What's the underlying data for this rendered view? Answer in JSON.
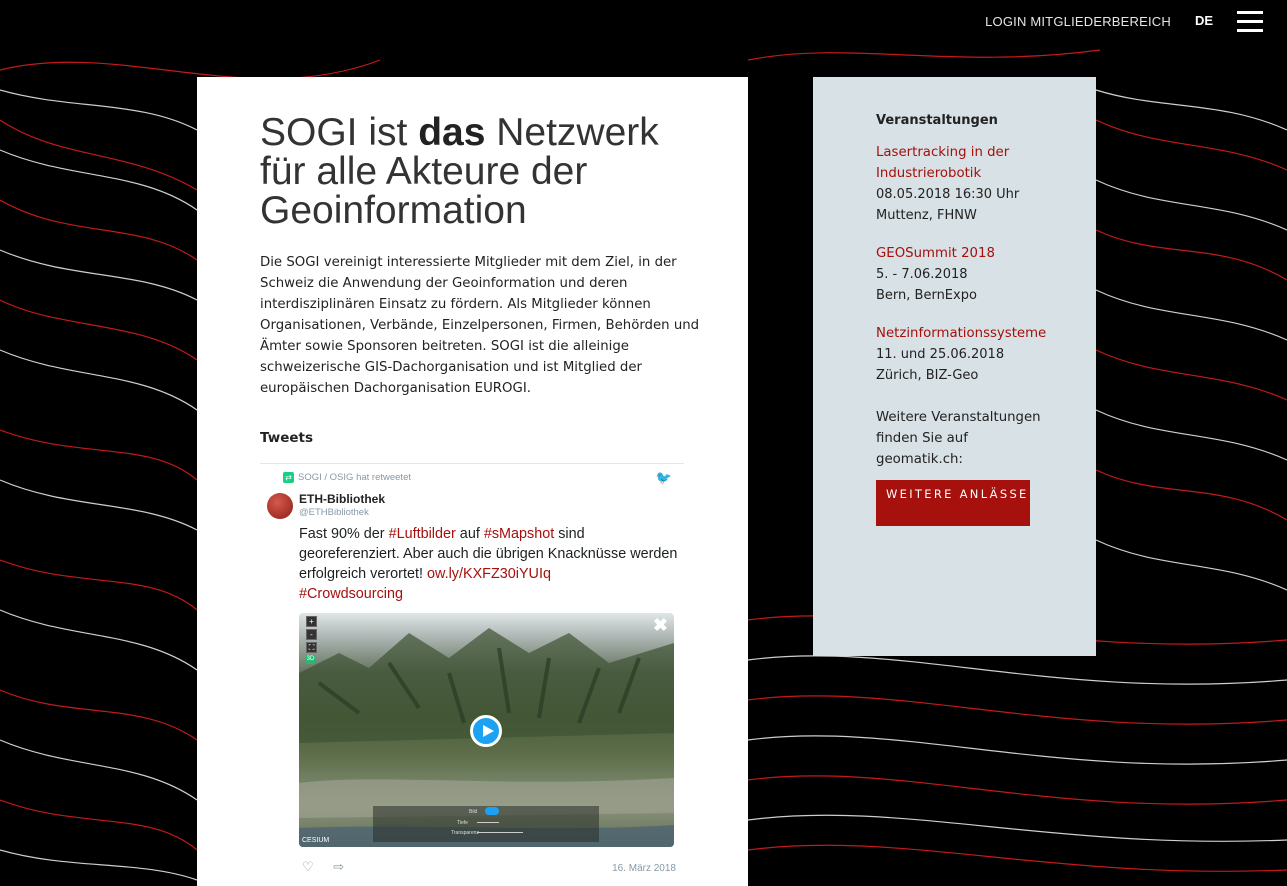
{
  "header": {
    "login_label": "LOGIN MITGLIEDERBEREICH",
    "language": "DE",
    "menu_icon": "hamburger-menu-icon"
  },
  "main": {
    "headline_part1": "SOGI ist ",
    "headline_bold": "das",
    "headline_part2": " Netzwerk für alle Akteure der Geoinformation",
    "intro": "Die SOGI vereinigt interessierte Mitglieder mit dem Ziel, in der Schweiz die Anwendung der Geoinformation und deren interdisziplinären Einsatz zu fördern. Als Mitglieder können Organisationen, Verbände, Einzelpersonen, Firmen, Behörden und Ämter sowie Sponsoren beitreten. SOGI ist die alleinige schweizerische GIS-Dachorganisation und ist Mitglied der europäischen Dachorganisation EUROGI.",
    "tweets_title": "Tweets"
  },
  "tweet": {
    "retweet_label": "SOGI / OSIG hat retweetet",
    "author": "ETH-Bibliothek",
    "handle": "@ETHBibliothek",
    "text_1": "Fast 90% der ",
    "link_1": "#Luftbilder",
    "text_2": " auf ",
    "link_2": "#sMapshot",
    "text_3": " sind georeferenziert. Aber auch die übrigen Knacknüsse werden erfolgreich verortet! ",
    "link_3": "ow.ly/KXFZ30iYUIq",
    "link_4": "#Crowdsourcing",
    "media_labels": {
      "bild": "Bild",
      "tiefe": "Tiefe",
      "transparenz": "Transparenz",
      "cesium": "CESIUM"
    },
    "date": "16. März 2018"
  },
  "sidebar": {
    "title": "Veranstaltungen",
    "events": [
      {
        "title": "Lasertracking in der Industrierobotik",
        "date": "08.05.2018  16:30 Uhr",
        "place": "Muttenz, FHNW"
      },
      {
        "title": "GEOSummit 2018",
        "date": "5. - 7.06.2018",
        "place": "Bern, BernExpo"
      },
      {
        "title": "Netzinformationssysteme",
        "date": "11. und 25.06.2018",
        "place": "Zürich, BIZ-Geo"
      }
    ],
    "more_text": "Weitere Veranstaltungen finden Sie auf geomatik.ch:",
    "more_button": "WEITERE ANLÄSSE"
  },
  "colors": {
    "accent": "#a6100d",
    "sidebar_bg": "#d8e1e5",
    "background": "#000000"
  }
}
